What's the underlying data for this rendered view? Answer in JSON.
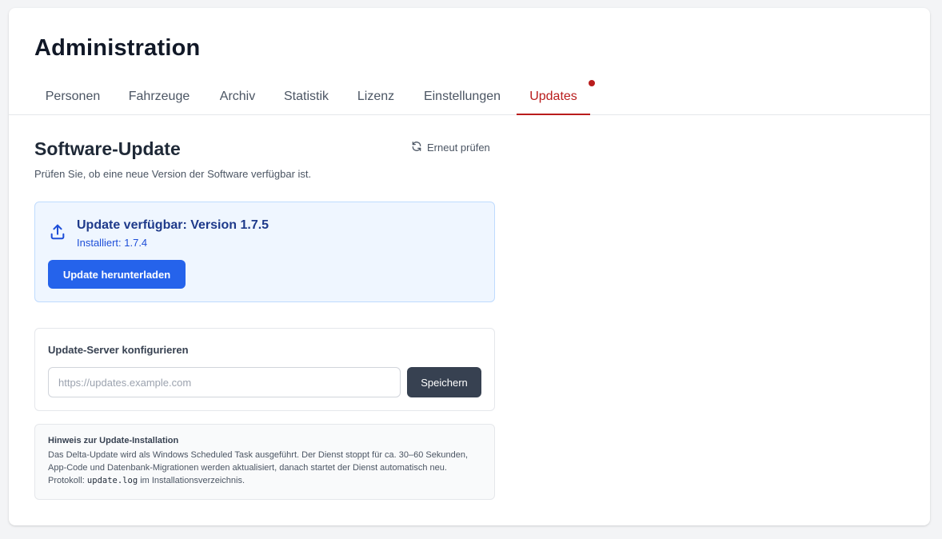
{
  "page": {
    "title": "Administration"
  },
  "tabs": [
    {
      "label": "Personen",
      "active": false
    },
    {
      "label": "Fahrzeuge",
      "active": false
    },
    {
      "label": "Archiv",
      "active": false
    },
    {
      "label": "Statistik",
      "active": false
    },
    {
      "label": "Lizenz",
      "active": false
    },
    {
      "label": "Einstellungen",
      "active": false
    },
    {
      "label": "Updates",
      "active": true,
      "has_notification": true
    }
  ],
  "section": {
    "title": "Software-Update",
    "subtitle": "Prüfen Sie, ob eine neue Version der Software verfügbar ist.",
    "recheck_label": "Erneut prüfen",
    "recheck_icon": "refresh-icon"
  },
  "update": {
    "title": "Update verfügbar: Version 1.7.5",
    "installed": "Installiert: 1.7.4",
    "download_label": "Update herunterladen",
    "icon": "upload-icon"
  },
  "server": {
    "label": "Update-Server konfigurieren",
    "placeholder": "https://updates.example.com",
    "value": "",
    "save_label": "Speichern"
  },
  "note": {
    "title": "Hinweis zur Update-Installation",
    "text_before": "Das Delta-Update wird als Windows Scheduled Task ausgeführt. Der Dienst stoppt für ca. 30–60 Sekunden, App-Code und Datenbank-Migrationen werden aktualisiert, danach startet der Dienst automatisch neu. Protokoll: ",
    "code": "update.log",
    "text_after": " im Installationsverzeichnis."
  },
  "colors": {
    "accent": "#b91c1c",
    "primary_button": "#2563eb",
    "dark_button": "#374151",
    "info_background": "#eff6ff"
  }
}
